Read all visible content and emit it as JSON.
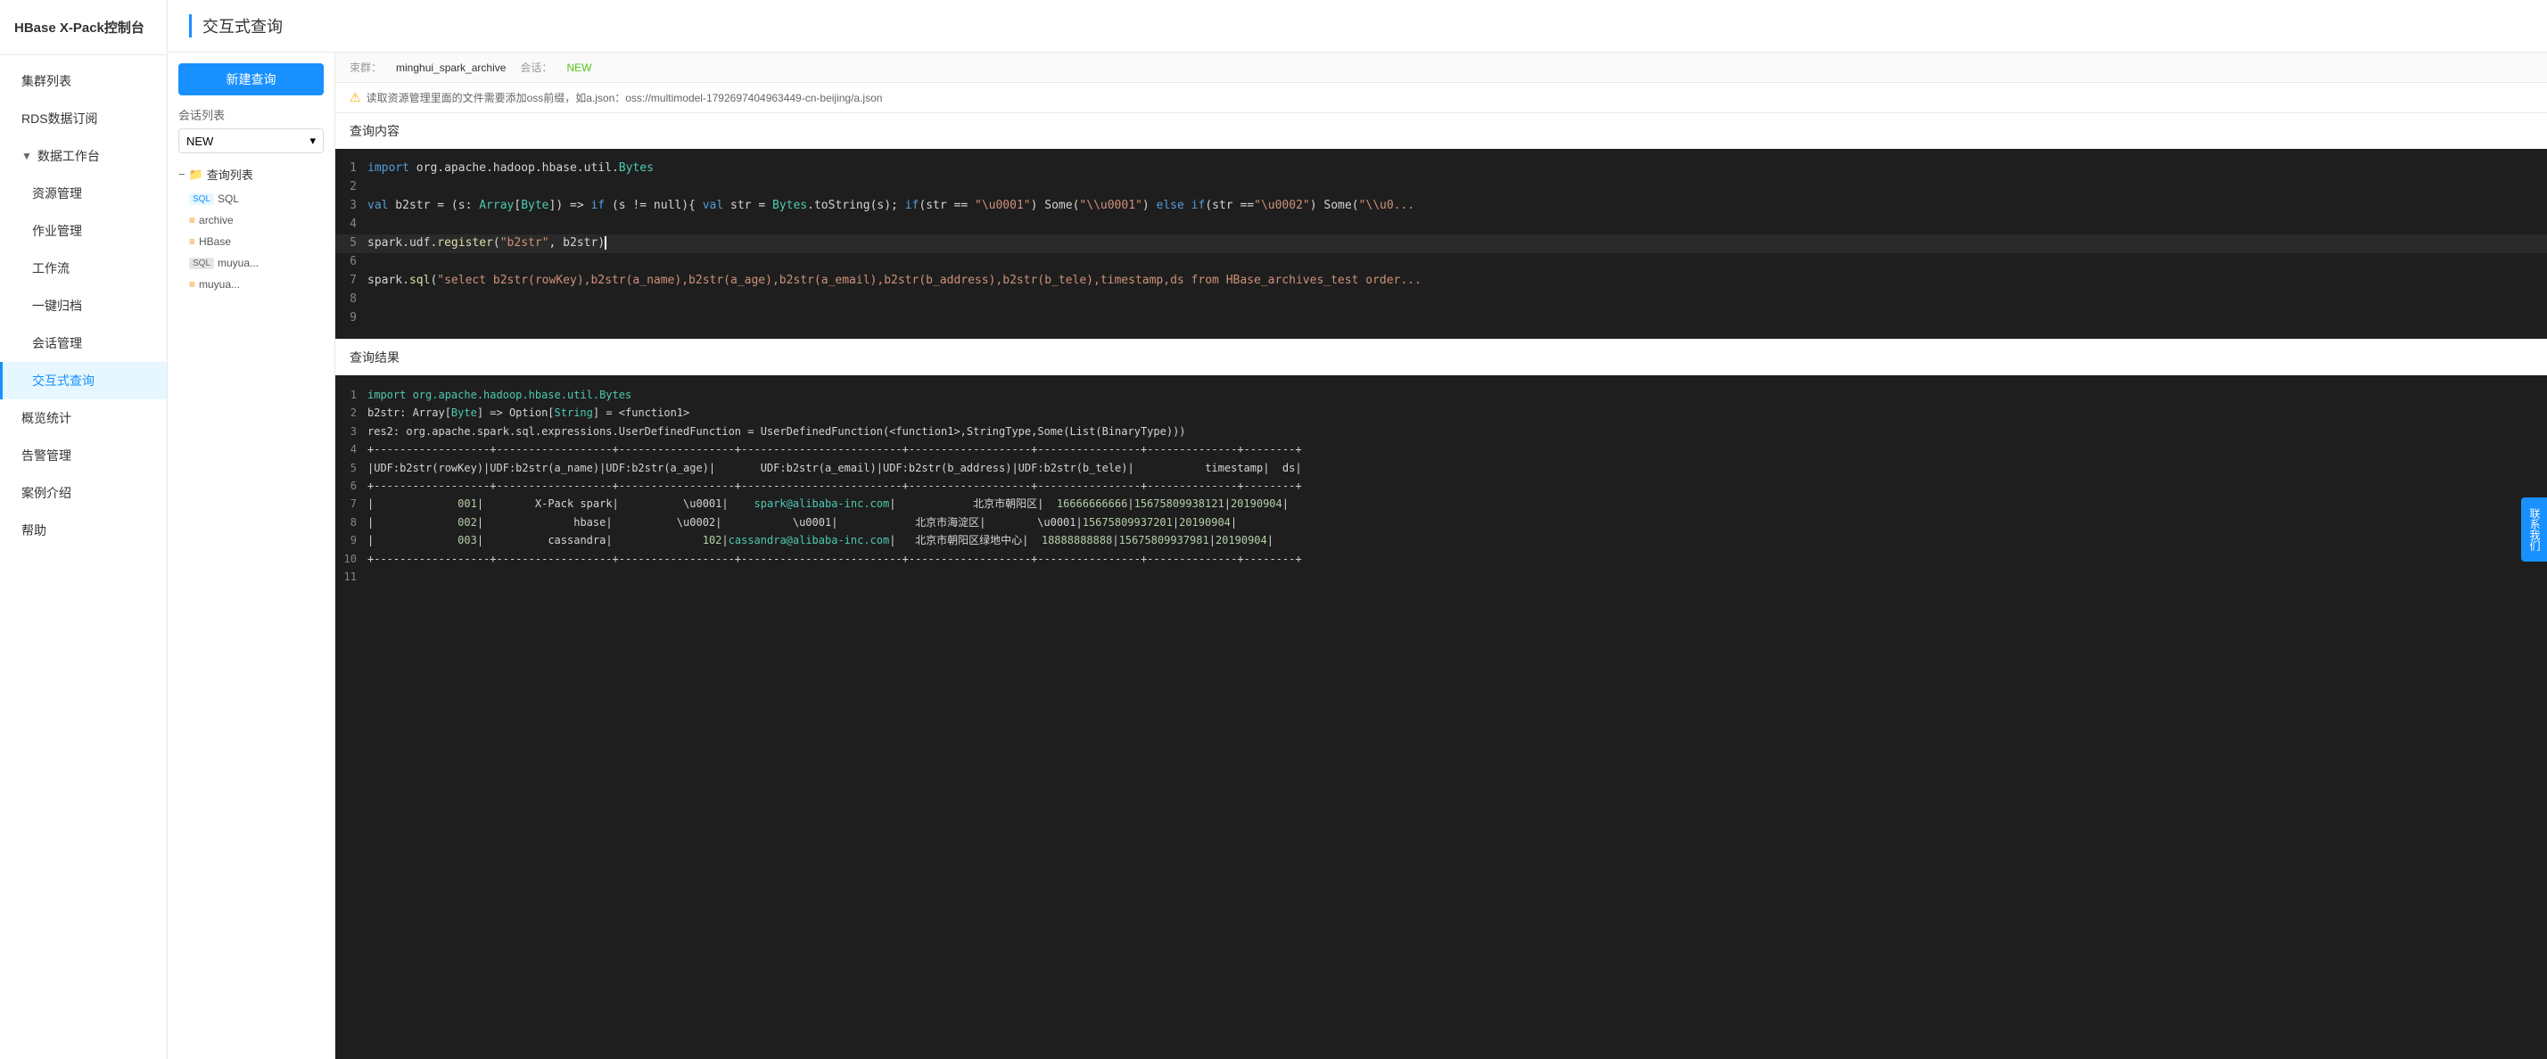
{
  "app": {
    "title": "HBase X-Pack控制台"
  },
  "sidebar": {
    "items": [
      {
        "id": "cluster-list",
        "label": "集群列表",
        "level": 0
      },
      {
        "id": "rds-subscribe",
        "label": "RDS数据订阅",
        "level": 0
      },
      {
        "id": "data-workbench",
        "label": "数据工作台",
        "level": 0,
        "arrow": "▼"
      },
      {
        "id": "resource-mgmt",
        "label": "资源管理",
        "level": 1
      },
      {
        "id": "job-mgmt",
        "label": "作业管理",
        "level": 1
      },
      {
        "id": "workflow",
        "label": "工作流",
        "level": 1
      },
      {
        "id": "archive",
        "label": "一键归档",
        "level": 1
      },
      {
        "id": "session-mgmt",
        "label": "会话管理",
        "level": 1
      },
      {
        "id": "interactive-query",
        "label": "交互式查询",
        "level": 1,
        "active": true
      },
      {
        "id": "overview-stats",
        "label": "概览统计",
        "level": 0
      },
      {
        "id": "alert-mgmt",
        "label": "告警管理",
        "level": 0
      },
      {
        "id": "case-intro",
        "label": "案例介绍",
        "level": 0
      },
      {
        "id": "help",
        "label": "帮助",
        "level": 0
      }
    ]
  },
  "page": {
    "title": "交互式查询",
    "new_query_btn": "新建查询",
    "session_label": "会话列表",
    "session_value": "NEW",
    "query_list_header": "查询列表",
    "query_items": [
      {
        "tag": "SQL",
        "tag_style": "normal",
        "name": "SQL"
      },
      {
        "tag": "",
        "tag_style": "icon",
        "name": "archive"
      },
      {
        "tag": "",
        "tag_style": "icon",
        "name": "HBase"
      },
      {
        "tag": "SQL",
        "tag_style": "normal",
        "name": "muyua..."
      },
      {
        "tag": "",
        "tag_style": "icon",
        "name": "muyua..."
      }
    ]
  },
  "top_bar": {
    "cluster_label": "束群：",
    "cluster_value": "minghui_spark_archive",
    "session_label": "会话：",
    "session_value": "NEW"
  },
  "info_bar": {
    "message": "读取资源管理里面的文件需要添加oss前缀，如a.json：oss://multimodel-1792697404963449-cn-beijing/a.json"
  },
  "query_content": {
    "title": "查询内容",
    "lines": [
      {
        "num": 1,
        "content": "import org.apache.hadoop.hbase.util.Bytes"
      },
      {
        "num": 2,
        "content": ""
      },
      {
        "num": 3,
        "content": "val b2str = (s: Array[Byte]) => if (s != null){ val str = Bytes.toString(s); if(str == \"\\u0001\") Some(\"\\\\u0001\") else if(str ==\"\\u0002\") Some(\"\\\\u0..."
      },
      {
        "num": 4,
        "content": ""
      },
      {
        "num": 5,
        "content": "spark.udf.register(\"b2str\", b2str)"
      },
      {
        "num": 6,
        "content": ""
      },
      {
        "num": 7,
        "content": "spark.sql(\"select b2str(rowKey),b2str(a_name),b2str(a_age),b2str(a_email),b2str(b_address),b2str(b_tele),timestamp,ds from HBase_archives_test order..."
      },
      {
        "num": 8,
        "content": ""
      },
      {
        "num": 9,
        "content": ""
      }
    ]
  },
  "query_results": {
    "title": "查询结果",
    "lines": [
      {
        "num": 1,
        "content": "import org.apache.hadoop.hbase.util.Bytes",
        "type": "import"
      },
      {
        "num": 2,
        "content": "b2str: Array[Byte] => Option[String] = <function1>",
        "type": "result"
      },
      {
        "num": 3,
        "content": "res2: org.apache.spark.sql.expressions.UserDefinedFunction = UserDefinedFunction(<function1>,StringType,Some(List(BinaryType)))",
        "type": "result"
      },
      {
        "num": 4,
        "content": "+--------------------------------------------------------------------------+-------------------------------+",
        "type": "separator"
      },
      {
        "num": 5,
        "content": "|UDF:b2str(rowKey)|UDF:b2str(a_name)|UDF:b2str(a_age)|       UDF:b2str(a_email)|UDF:b2str(b_address)|UDF:b2str(b_tele)|           timestamp|  ds|",
        "type": "header"
      },
      {
        "num": 6,
        "content": "+--------------------------------------------------------------------------+-------------------------------+",
        "type": "separator"
      },
      {
        "num": 7,
        "content": "|             001|        X-Pack spark|          \\u0001|    spark@alibaba-inc.com|            北京市朝阳区|  16666666666|15675809938121|20190904|",
        "type": "data"
      },
      {
        "num": 8,
        "content": "|             002|              hbase|          \\u0002|           \\u0001|            北京市海淀区|        \\u0001|15675809937201|20190904|",
        "type": "data"
      },
      {
        "num": 9,
        "content": "|             003|          cassandra|              102|cassandra@alibaba-inc.com|   北京市朝阳区绿地中心|  18888888888|15675809937981|20190904|",
        "type": "data"
      },
      {
        "num": 10,
        "content": "+--------------------------------------------------------------------------+-------------------------------+",
        "type": "separator"
      },
      {
        "num": 11,
        "content": "",
        "type": "empty"
      }
    ]
  },
  "float_btn": {
    "label": "联系我们"
  }
}
